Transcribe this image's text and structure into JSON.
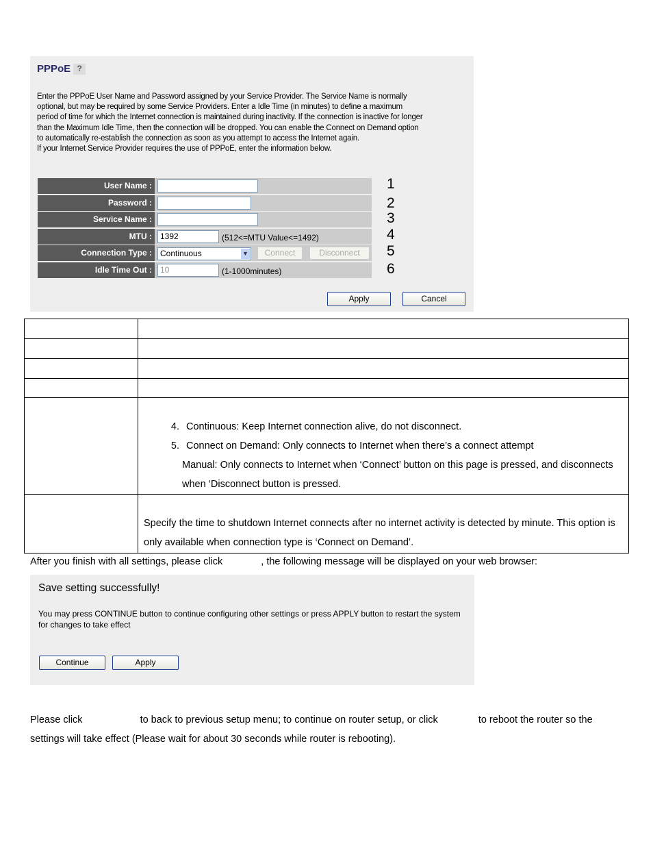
{
  "pppoe": {
    "title": "PPPoE",
    "help_icon": "help-icon",
    "description": [
      "Enter the PPPoE User Name and Password assigned by your Service Provider. The Service Name is normally",
      "optional, but may be required by some Service Providers. Enter a Idle Time (in minutes) to define a maximum",
      "period of time for which the Internet connection is maintained during inactivity. If the connection is inactive for longer",
      "than the Maximum Idle Time, then the connection will be dropped. You can enable the Connect on Demand option",
      "to automatically re-establish the connection as soon as you attempt to access the Internet again.",
      "If your Internet Service Provider requires the use of PPPoE, enter the information below."
    ],
    "fields": {
      "user_name": {
        "label": "User Name :",
        "value": "",
        "num": "1"
      },
      "password": {
        "label": "Password :",
        "value": "",
        "num": "2"
      },
      "service_name": {
        "label": "Service Name :",
        "value": "",
        "num": "3"
      },
      "mtu": {
        "label": "MTU :",
        "value": "1392",
        "hint": "(512<=MTU Value<=1492)",
        "num": "4"
      },
      "connection_type": {
        "label": "Connection Type :",
        "value": "Continuous",
        "connect": "Connect",
        "disconnect": "Disconnect",
        "num": "5"
      },
      "idle": {
        "label": "Idle Time Out :",
        "value": "10",
        "hint": "(1-1000minutes)",
        "num": "6"
      }
    },
    "apply": "Apply",
    "cancel": "Cancel"
  },
  "table": {
    "conn_items": [
      "Continuous: Keep Internet connection alive, do not disconnect.",
      "Connect on Demand: Only connects to Internet when there’s a connect attempt"
    ],
    "manual": "Manual: Only connects to Internet when ‘Connect’ button on this page is pressed, and disconnects when ‘Disconnect button is pressed.",
    "idle_desc": "Specify the time to shutdown Internet connects after no internet activity is detected by minute. This option is only available when connection type is ‘Connect on Demand’."
  },
  "after_a": "After you finish with all settings, please click",
  "after_b": ", the following message will be displayed on your web browser:",
  "saved": {
    "title": "Save setting successfully!",
    "msg": "You may press CONTINUE button to continue configuring other settings or press APPLY button to restart the system for changes to take effect",
    "continue": "Continue",
    "apply": "Apply"
  },
  "final": {
    "a": "Please click",
    "b": "to back to previous setup menu; to continue on router setup, or click",
    "c": "to reboot the router so the",
    "d": "settings will take effect (Please wait for about 30 seconds while router is rebooting)."
  }
}
